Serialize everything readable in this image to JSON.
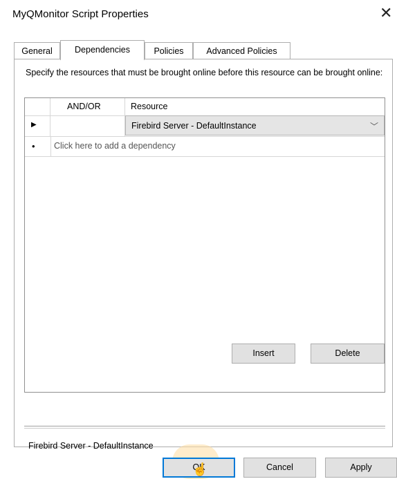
{
  "window": {
    "title": "MyQMonitor Script Properties",
    "close_icon": "close-icon"
  },
  "tabs": [
    {
      "label": "General",
      "active": false
    },
    {
      "label": "Dependencies",
      "active": true
    },
    {
      "label": "Policies",
      "active": false
    },
    {
      "label": "Advanced Policies",
      "active": false
    }
  ],
  "panel": {
    "description": "Specify the resources that must be brought online before this resource can be brought online:",
    "grid": {
      "columns": [
        "AND/OR",
        "Resource"
      ],
      "rows": [
        {
          "andor": "",
          "resource": "Firebird Server - DefaultInstance",
          "selected": true
        }
      ],
      "add_row_text": "Click here to add a dependency"
    },
    "buttons": {
      "insert": "Insert",
      "delete": "Delete"
    },
    "info_text": "Firebird Server - DefaultInstance"
  },
  "footer": {
    "ok": "OK",
    "cancel": "Cancel",
    "apply": "Apply"
  }
}
